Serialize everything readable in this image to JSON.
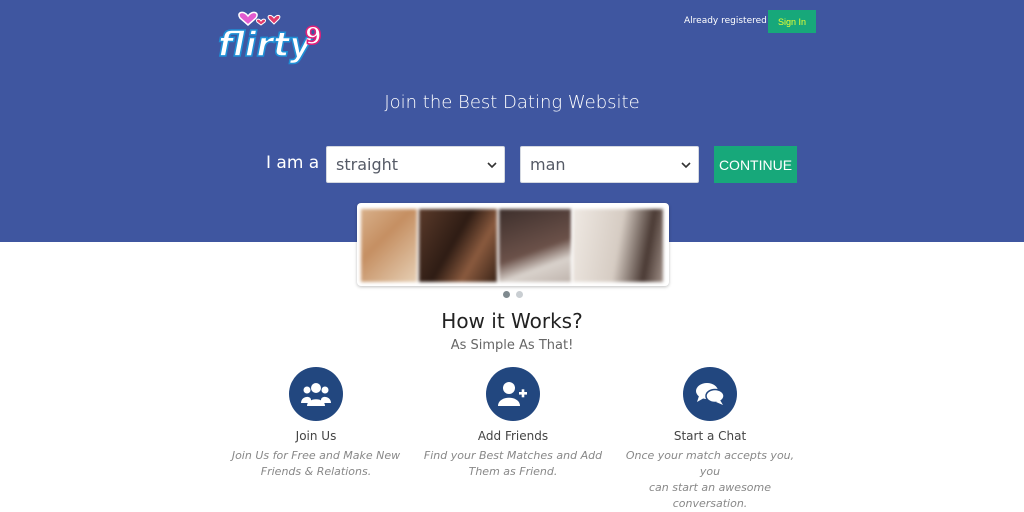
{
  "header": {
    "logo_text": "flirty9",
    "already_registered": "Already registered ?",
    "signin_label": "Sign In"
  },
  "hero": {
    "headline": "Join the Best Dating Website",
    "iam_label": "I am a",
    "orientation": {
      "selected": "straight"
    },
    "gender": {
      "selected": "man"
    },
    "continue_label": "CONTINUE"
  },
  "carousel": {
    "total_slides": 2,
    "active_slide": 1
  },
  "how": {
    "title": "How it Works?",
    "subtitle": "As Simple As That!"
  },
  "features": [
    {
      "icon": "group-icon",
      "title": "Join Us",
      "desc_line1": "Join Us for Free and Make New",
      "desc_line2": "Friends & Relations."
    },
    {
      "icon": "add-friend-icon",
      "title": "Add Friends",
      "desc_line1": "Find your Best Matches and Add",
      "desc_line2": "Them as Friend."
    },
    {
      "icon": "chat-icon",
      "title": "Start a Chat",
      "desc_line1": "Once your match accepts you, you",
      "desc_line2": "can start an awesome",
      "desc_line3": "conversation."
    }
  ],
  "colors": {
    "hero_bg": "#3f56a0",
    "accent_green": "#17a87a",
    "icon_circle": "#22477f",
    "signin_text": "#e8ff33"
  }
}
